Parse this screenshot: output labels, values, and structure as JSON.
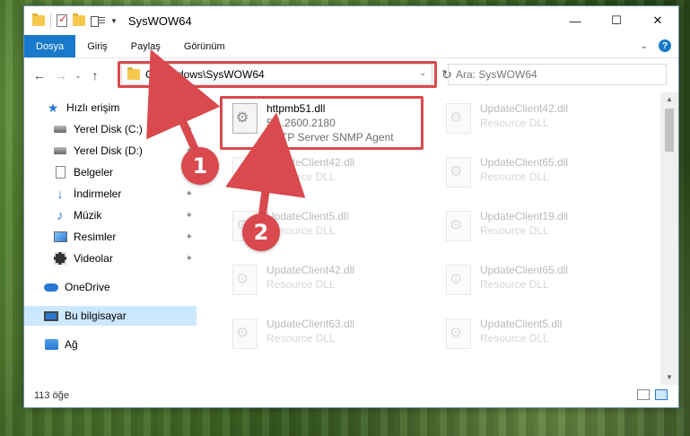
{
  "window": {
    "title": "SysWOW64",
    "controls": {
      "minimize": "—",
      "maximize": "☐",
      "close": "✕"
    }
  },
  "ribbon": {
    "tabs": [
      "Dosya",
      "Giriş",
      "Paylaş",
      "Görünüm"
    ]
  },
  "navigation": {
    "back": "←",
    "forward": "→",
    "recent": "⌄",
    "up": "↑",
    "address": "C:\\Windows\\SysWOW64",
    "refresh": "↻",
    "search_placeholder": "Ara: SysWOW64"
  },
  "sidebar": {
    "items": [
      {
        "label": "Hızlı erişim",
        "icon": "star-icon"
      },
      {
        "label": "Yerel Disk (C:)",
        "icon": "disk-icon",
        "pinned": true
      },
      {
        "label": "Yerel Disk (D:)",
        "icon": "disk-icon",
        "pinned": true
      },
      {
        "label": "Belgeler",
        "icon": "document-icon",
        "pinned": true
      },
      {
        "label": "İndirmeler",
        "icon": "download-icon",
        "pinned": true
      },
      {
        "label": "Müzik",
        "icon": "music-icon",
        "pinned": true
      },
      {
        "label": "Resimler",
        "icon": "pictures-icon",
        "pinned": true
      },
      {
        "label": "Videolar",
        "icon": "videos-icon",
        "pinned": true
      },
      {
        "label": "OneDrive",
        "icon": "cloud-icon"
      },
      {
        "label": "Bu bilgisayar",
        "icon": "computer-icon",
        "selected": true
      },
      {
        "label": "Ağ",
        "icon": "network-icon"
      }
    ]
  },
  "files": [
    {
      "name": "httpmb51.dll",
      "line2": "5.1.2600.2180",
      "line3": "HTTP Server SNMP Agent"
    },
    {
      "name": "UpdateClient42.dll",
      "line2": "Resource DLL"
    },
    {
      "name": "UpdateClient42.dll",
      "line2": "Resource DLL"
    },
    {
      "name": "UpdateClient65.dll",
      "line2": "Resource DLL"
    },
    {
      "name": "UpdateClient5.dll",
      "line2": "Resource DLL"
    },
    {
      "name": "UpdateClient19.dll",
      "line2": "Resource DLL"
    },
    {
      "name": "UpdateClient42.dll",
      "line2": "Resource DLL"
    },
    {
      "name": "UpdateClient65.dll",
      "line2": "Resource DLL"
    },
    {
      "name": "UpdateClient63.dll",
      "line2": "Resource DLL"
    },
    {
      "name": "UpdateClient5.dll",
      "line2": "Resource DLL"
    }
  ],
  "status": {
    "count": "113 öğe"
  },
  "markers": [
    "1",
    "2"
  ],
  "colors": {
    "accent": "#1979ca",
    "highlight": "#d9494d",
    "selected": "#cce8ff"
  }
}
